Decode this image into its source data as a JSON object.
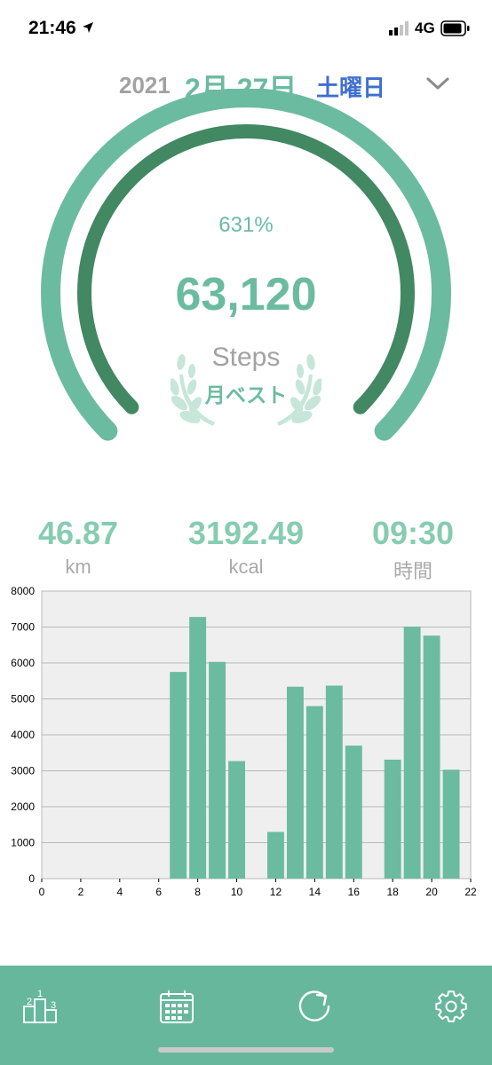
{
  "status": {
    "time": "21:46",
    "network": "4G"
  },
  "header": {
    "year": "2021",
    "month_day": "2月 27日",
    "weekday": "土曜日"
  },
  "activity": {
    "percent_text": "631%",
    "ring_fraction": 1.0,
    "steps": "63,120",
    "steps_label": "Steps",
    "best_label": "月ベスト"
  },
  "stats": [
    {
      "value": "46.87",
      "unit": "km"
    },
    {
      "value": "3192.49",
      "unit": "kcal"
    },
    {
      "value": "09:30",
      "unit": "時間"
    }
  ],
  "colors": {
    "accent": "#6bbba0",
    "ring_outer": "#6bbba0",
    "ring_inner": "#428863",
    "weekday": "#3f6fd0",
    "tab_bar": "#67b79c"
  },
  "chart_data": {
    "type": "bar",
    "x": [
      0,
      1,
      2,
      3,
      4,
      5,
      6,
      7,
      8,
      9,
      10,
      11,
      12,
      13,
      14,
      15,
      16,
      17,
      18,
      19,
      20,
      21
    ],
    "values": [
      0,
      0,
      0,
      0,
      0,
      0,
      0,
      5750,
      7280,
      6030,
      3270,
      0,
      1300,
      5340,
      4800,
      5370,
      3700,
      0,
      3310,
      7010,
      6760,
      3030
    ],
    "xticks": [
      0,
      2,
      4,
      6,
      8,
      10,
      12,
      14,
      16,
      18,
      20,
      22
    ],
    "yticks": [
      0,
      1000,
      2000,
      3000,
      4000,
      5000,
      6000,
      7000,
      8000
    ],
    "xlim": [
      0,
      22
    ],
    "ylim": [
      0,
      8000
    ],
    "grid": true,
    "color": "#6bbba0"
  },
  "tabs": [
    {
      "icon": "ranking-podium-icon"
    },
    {
      "icon": "calendar-icon"
    },
    {
      "icon": "refresh-icon"
    },
    {
      "icon": "settings-gear-icon"
    }
  ]
}
